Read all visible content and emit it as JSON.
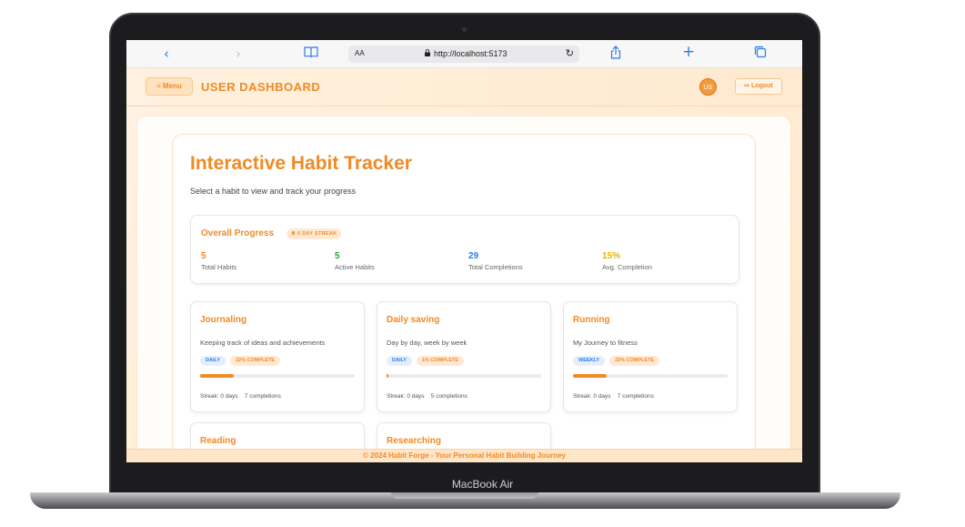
{
  "device": {
    "label": "MacBook Air"
  },
  "browser": {
    "back_icon": "chevron-left-icon",
    "forward_icon": "chevron-right-icon",
    "text_size": "AA",
    "url": "http://localhost:5173"
  },
  "header": {
    "menu_label": "Menu",
    "title": "USER DASHBOARD",
    "avatar_initials": "US",
    "logout_label": "Logout"
  },
  "main": {
    "title": "Interactive Habit Tracker",
    "subtitle": "Select a habit to view and track your progress",
    "overall": {
      "title": "Overall Progress",
      "streak_badge": "0 DAY STREAK",
      "stats": [
        {
          "value": "5",
          "label": "Total Habits",
          "color": "#f08a24"
        },
        {
          "value": "5",
          "label": "Active Habits",
          "color": "#2e9e3e"
        },
        {
          "value": "29",
          "label": "Total Completions",
          "color": "#2b7de9"
        },
        {
          "value": "15%",
          "label": "Avg. Completion",
          "color": "#e8b400"
        }
      ]
    },
    "habits": [
      {
        "name": "Journaling",
        "description": "Keeping track of ideas and achievements",
        "frequency": "DAILY",
        "percent_label": "22% COMPLETE",
        "progress": 0.22,
        "streak": "Streak: 0 days",
        "completions": "7 completions"
      },
      {
        "name": "Daily saving",
        "description": "Day by day, week by week",
        "frequency": "DAILY",
        "percent_label": "1% COMPLETE",
        "progress": 0.01,
        "streak": "Streak: 0 days",
        "completions": "5 completions"
      },
      {
        "name": "Running",
        "description": "My Journey to fitness",
        "frequency": "WEEKLY",
        "percent_label": "22% COMPLETE",
        "progress": 0.22,
        "streak": "Streak: 0 days",
        "completions": "7 completions"
      },
      {
        "name": "Reading"
      },
      {
        "name": "Researching"
      }
    ]
  },
  "footer": {
    "text": "© 2024 Habit Forge - Your Personal Habit Building Journey"
  }
}
